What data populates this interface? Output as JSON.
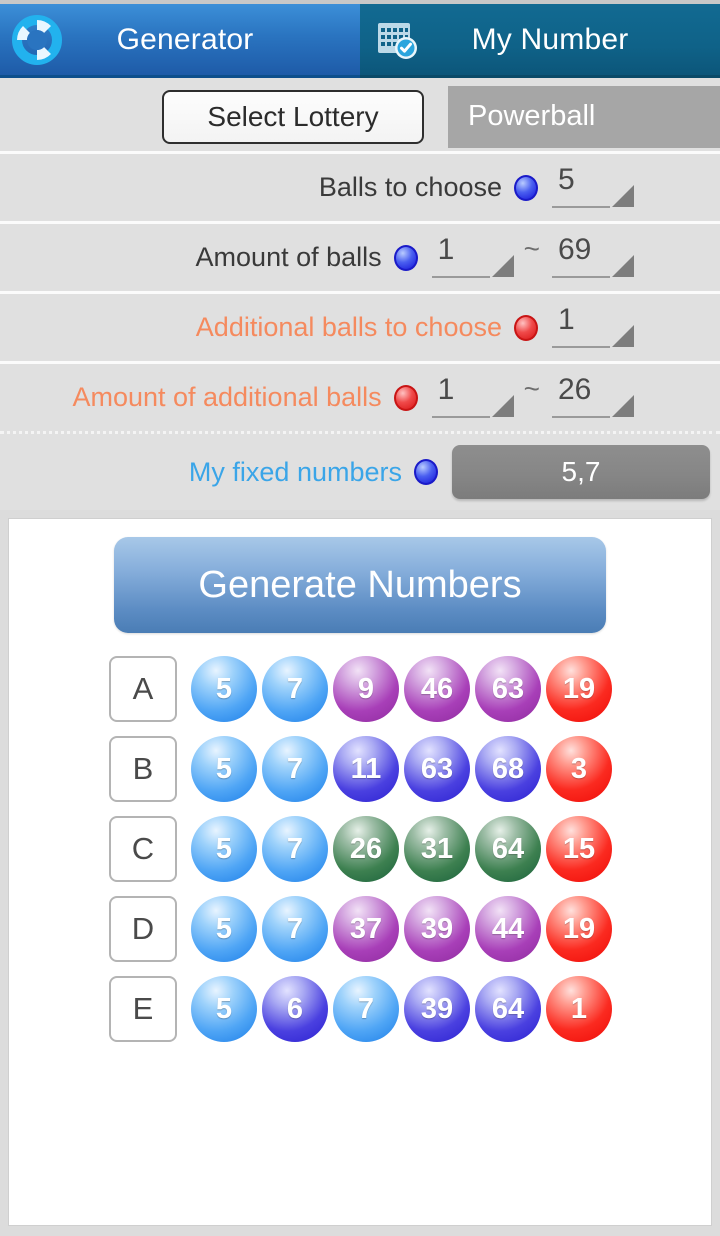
{
  "tabs": [
    {
      "label": "Generator",
      "icon": "lifebuoy-ring-icon",
      "active": true
    },
    {
      "label": "My Number",
      "icon": "calendar-check-icon",
      "active": false
    }
  ],
  "settings": {
    "select_lottery_button": "Select Lottery",
    "lottery_value": "Powerball",
    "rows": [
      {
        "label": "Balls to choose",
        "dot": "blue",
        "min": "5",
        "max": "",
        "range": false
      },
      {
        "label": "Amount of balls",
        "dot": "blue",
        "min": "1",
        "max": "69",
        "range": true,
        "separator": "~"
      },
      {
        "label": "Additional balls to choose",
        "dot": "red",
        "min": "1",
        "max": "",
        "range": false
      },
      {
        "label": "Amount of additional balls",
        "dot": "red",
        "min": "1",
        "max": "26",
        "range": true,
        "separator": "~"
      }
    ],
    "fixed_numbers_label": "My fixed numbers",
    "fixed_numbers_value": "5,7"
  },
  "generate_button": "Generate Numbers",
  "results": [
    {
      "label": "A",
      "balls": [
        {
          "n": "5",
          "color": "lightblue"
        },
        {
          "n": "7",
          "color": "lightblue"
        },
        {
          "n": "9",
          "color": "purple"
        },
        {
          "n": "46",
          "color": "purple"
        },
        {
          "n": "63",
          "color": "purple"
        },
        {
          "n": "19",
          "color": "red"
        }
      ]
    },
    {
      "label": "B",
      "balls": [
        {
          "n": "5",
          "color": "lightblue"
        },
        {
          "n": "7",
          "color": "lightblue"
        },
        {
          "n": "11",
          "color": "indigo"
        },
        {
          "n": "63",
          "color": "indigo"
        },
        {
          "n": "68",
          "color": "indigo"
        },
        {
          "n": "3",
          "color": "red"
        }
      ]
    },
    {
      "label": "C",
      "balls": [
        {
          "n": "5",
          "color": "lightblue"
        },
        {
          "n": "7",
          "color": "lightblue"
        },
        {
          "n": "26",
          "color": "green"
        },
        {
          "n": "31",
          "color": "green"
        },
        {
          "n": "64",
          "color": "green"
        },
        {
          "n": "15",
          "color": "red"
        }
      ]
    },
    {
      "label": "D",
      "balls": [
        {
          "n": "5",
          "color": "lightblue"
        },
        {
          "n": "7",
          "color": "lightblue"
        },
        {
          "n": "37",
          "color": "purple"
        },
        {
          "n": "39",
          "color": "purple"
        },
        {
          "n": "44",
          "color": "purple"
        },
        {
          "n": "19",
          "color": "red"
        }
      ]
    },
    {
      "label": "E",
      "balls": [
        {
          "n": "5",
          "color": "lightblue"
        },
        {
          "n": "6",
          "color": "indigo"
        },
        {
          "n": "7",
          "color": "lightblue"
        },
        {
          "n": "39",
          "color": "indigo"
        },
        {
          "n": "64",
          "color": "indigo"
        },
        {
          "n": "1",
          "color": "red"
        }
      ]
    }
  ],
  "colors": {
    "tab_active": "#2a74c0",
    "tab_inactive": "#0f6288",
    "settings_bg": "#e0e0e0",
    "extra_label": "#f58a5e",
    "fixed_label": "#3aa5e8",
    "value_box": "#a6a6a6"
  }
}
